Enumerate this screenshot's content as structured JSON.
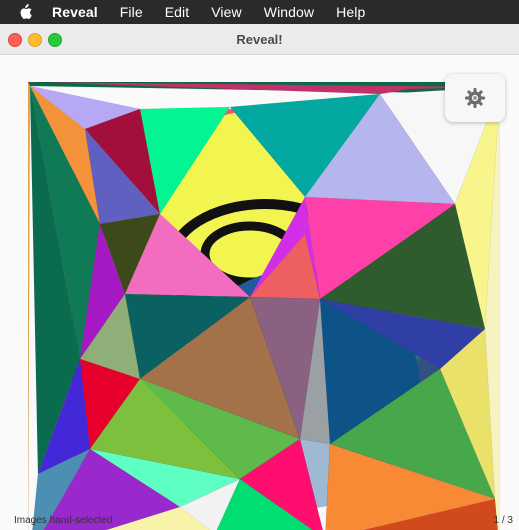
{
  "menubar": {
    "apple_icon": "apple-logo-icon",
    "items": [
      "Reveal",
      "File",
      "Edit",
      "View",
      "Window",
      "Help"
    ]
  },
  "window": {
    "title": "Reveal!",
    "settings_icon": "gear-icon"
  },
  "status": {
    "left": "Images hand-selected",
    "right": "1 / 3"
  },
  "colors": {
    "menubar_bg": "#2a2a2c",
    "close": "#fe5f57",
    "minimize": "#febc2e",
    "maximize": "#28c840"
  }
}
